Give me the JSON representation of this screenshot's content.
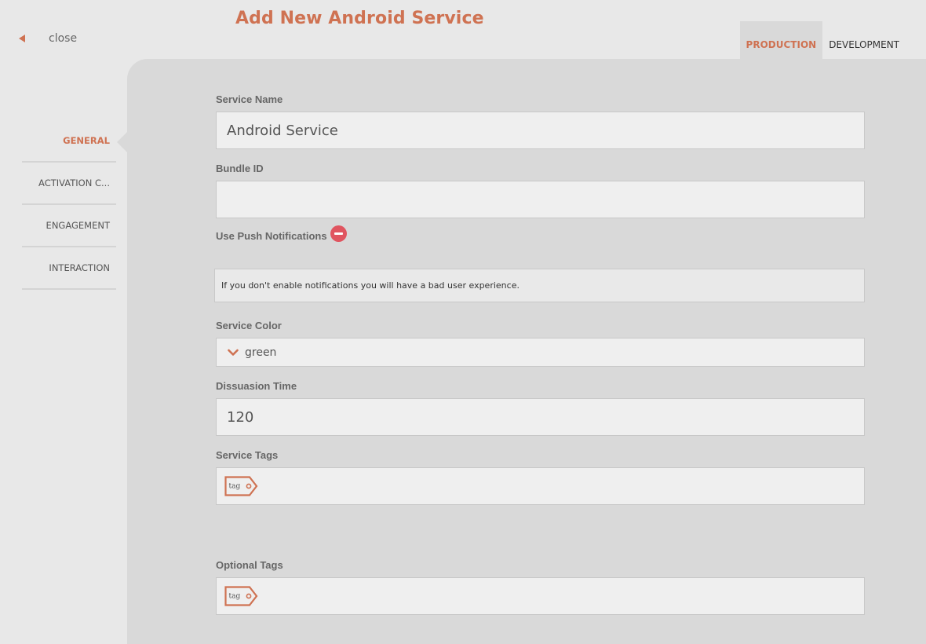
{
  "header": {
    "close_label": "close",
    "title": "Add New Android Service",
    "env_tabs": [
      {
        "label": "PRODUCTION",
        "active": true
      },
      {
        "label": "DEVELOPMENT",
        "active": false
      }
    ]
  },
  "sidebar": {
    "items": [
      {
        "label": "GENERAL",
        "active": true
      },
      {
        "label": "ACTIVATION C...",
        "active": false
      },
      {
        "label": "ENGAGEMENT",
        "active": false
      },
      {
        "label": "INTERACTION",
        "active": false
      }
    ]
  },
  "form": {
    "service_name": {
      "label": "Service Name",
      "value": "Android Service"
    },
    "bundle_id": {
      "label": "Bundle ID",
      "value": ""
    },
    "push": {
      "label": "Use Push Notifications",
      "icon": "minus-circle-icon"
    },
    "notice": "If you don't enable notifications you will have a bad user experience.",
    "service_color": {
      "label": "Service Color",
      "value": "green"
    },
    "dissuasion_time": {
      "label": "Dissuasion Time",
      "value": "120"
    },
    "service_tags": {
      "label": "Service Tags",
      "tag_icon_text": "tag"
    },
    "optional_tags": {
      "label": "Optional Tags",
      "tag_icon_text": "tag"
    }
  },
  "colors": {
    "accent": "#cf7252",
    "background": "#e8e8e8",
    "panel": "#d9d9d9",
    "input_bg": "#efefef",
    "danger": "#e05560"
  }
}
